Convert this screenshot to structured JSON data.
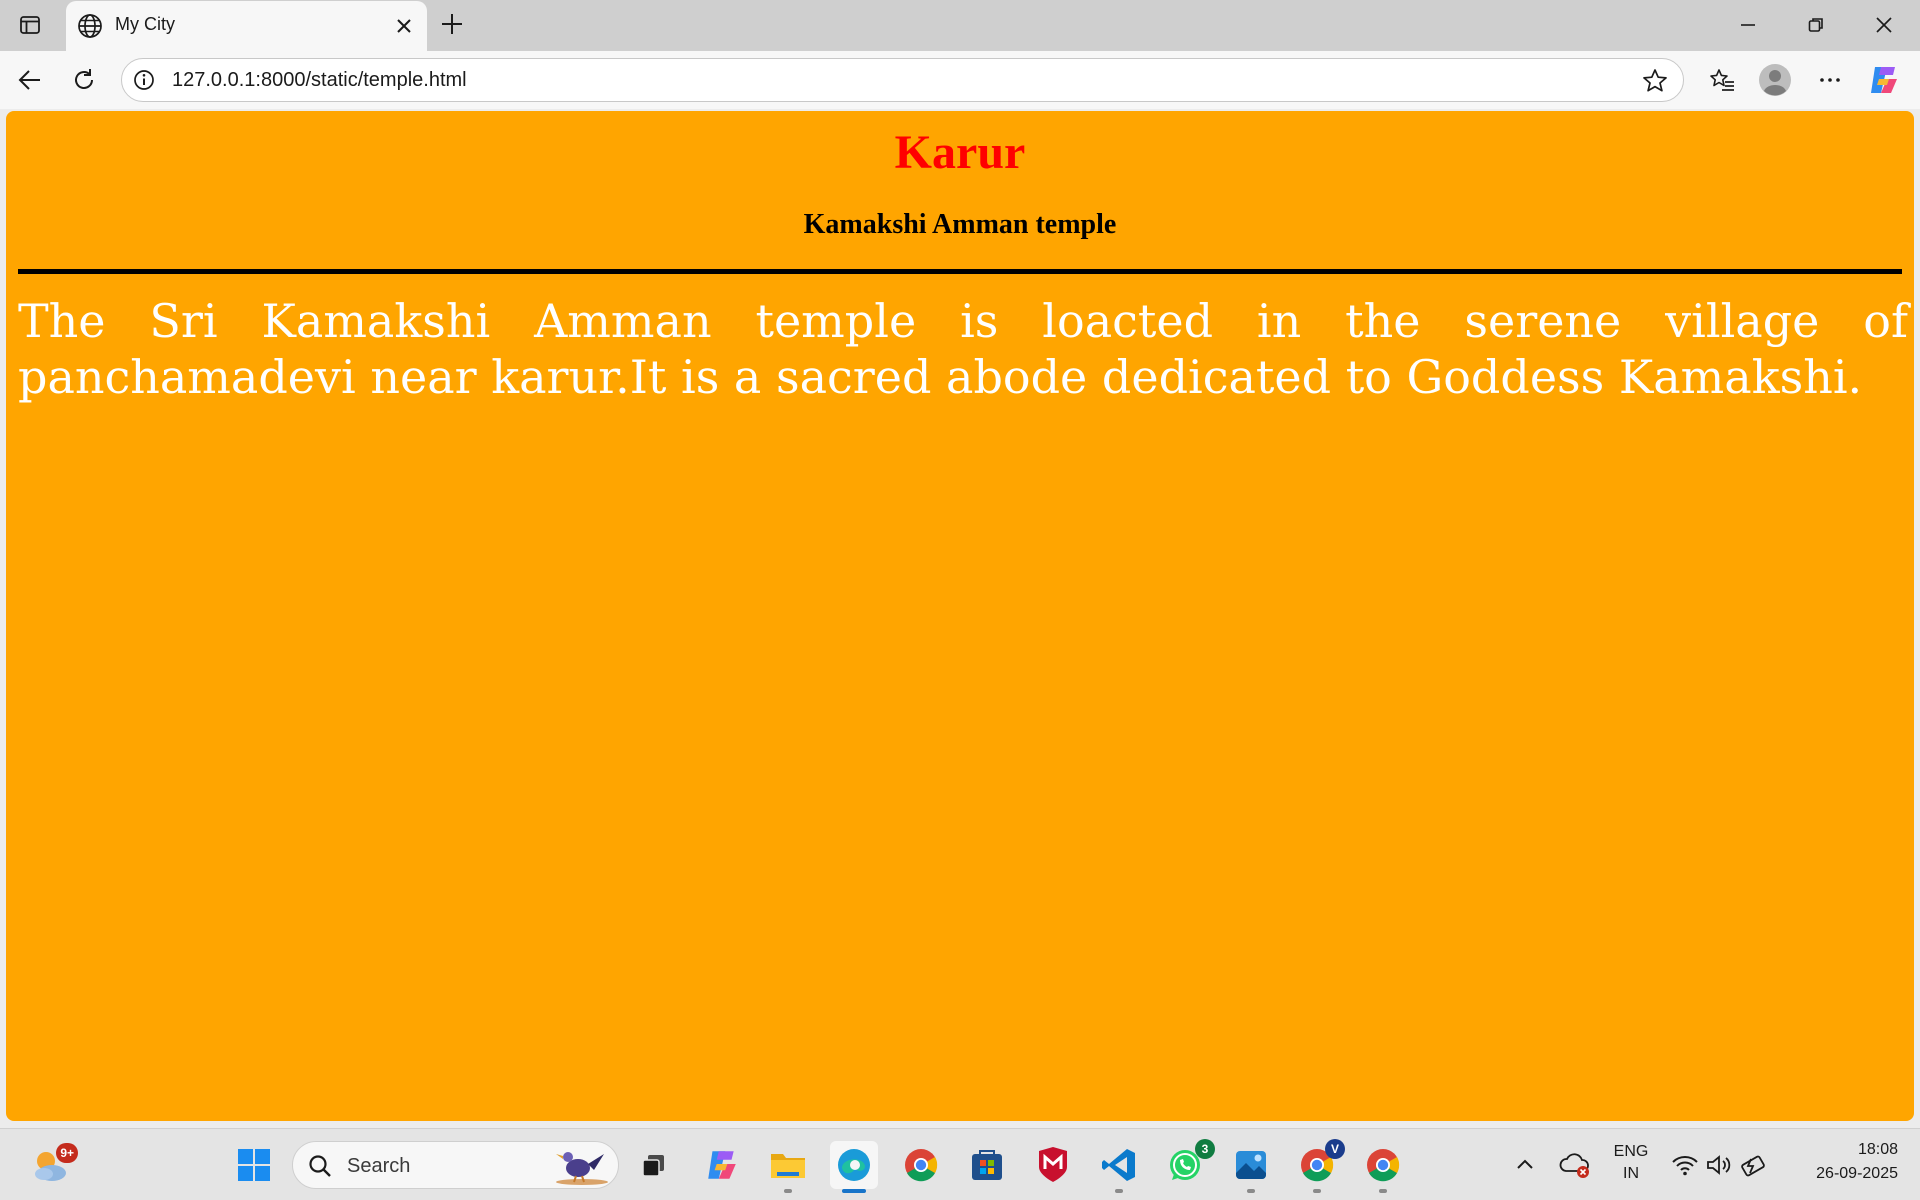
{
  "browser": {
    "tab": {
      "title": "My City",
      "favicon": "globe-icon"
    },
    "address": {
      "url": "127.0.0.1:8000/static/temple.html"
    }
  },
  "page": {
    "background": "#ffa500",
    "heading": "Karur",
    "heading_color": "#ff0000",
    "subheading": "Kamakshi Amman temple",
    "paragraph": "The Sri Kamakshi Amman temple is loacted in the serene village of panchamadevi near karur.It is a sacred abode dedicated to Goddess Kamakshi.",
    "paragraph_color": "#ffffff"
  },
  "taskbar": {
    "weather_badge": "9+",
    "search_label": "Search",
    "whatsapp_badge": "3",
    "chrome_profile_badge": "V",
    "language_line1": "ENG",
    "language_line2": "IN",
    "time": "18:08",
    "date": "26-09-2025"
  }
}
